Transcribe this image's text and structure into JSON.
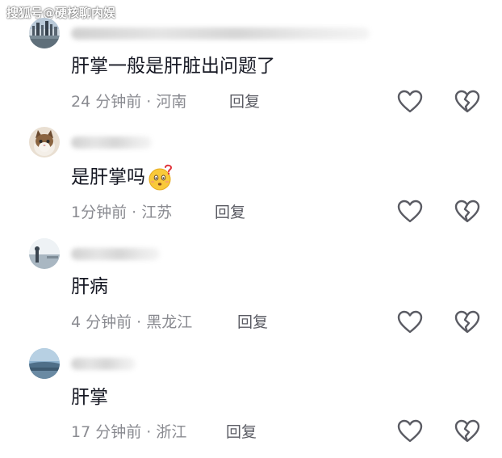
{
  "watermark": "搜狐号@硬核聊内娱",
  "comments": [
    {
      "text": "肝掌一般是肝脏出问题了",
      "time": "24 分钟前",
      "location": "河南",
      "reply_label": "回复"
    },
    {
      "text": "是肝掌吗",
      "emoji": "face-with-question-icon",
      "time": "1分钟前",
      "location": "江苏",
      "reply_label": "回复"
    },
    {
      "text": "肝病",
      "time": "4 分钟前",
      "location": "黑龙江",
      "reply_label": "回复"
    },
    {
      "text": "肝掌",
      "time": "17 分钟前",
      "location": "浙江",
      "reply_label": "回复"
    }
  ],
  "meta_separator": " · ",
  "icons": {
    "like": "heart-outline-icon",
    "dislike": "broken-heart-outline-icon"
  },
  "colors": {
    "text": "#161823",
    "meta": "#8a8b91",
    "icon": "#5a5b63"
  }
}
